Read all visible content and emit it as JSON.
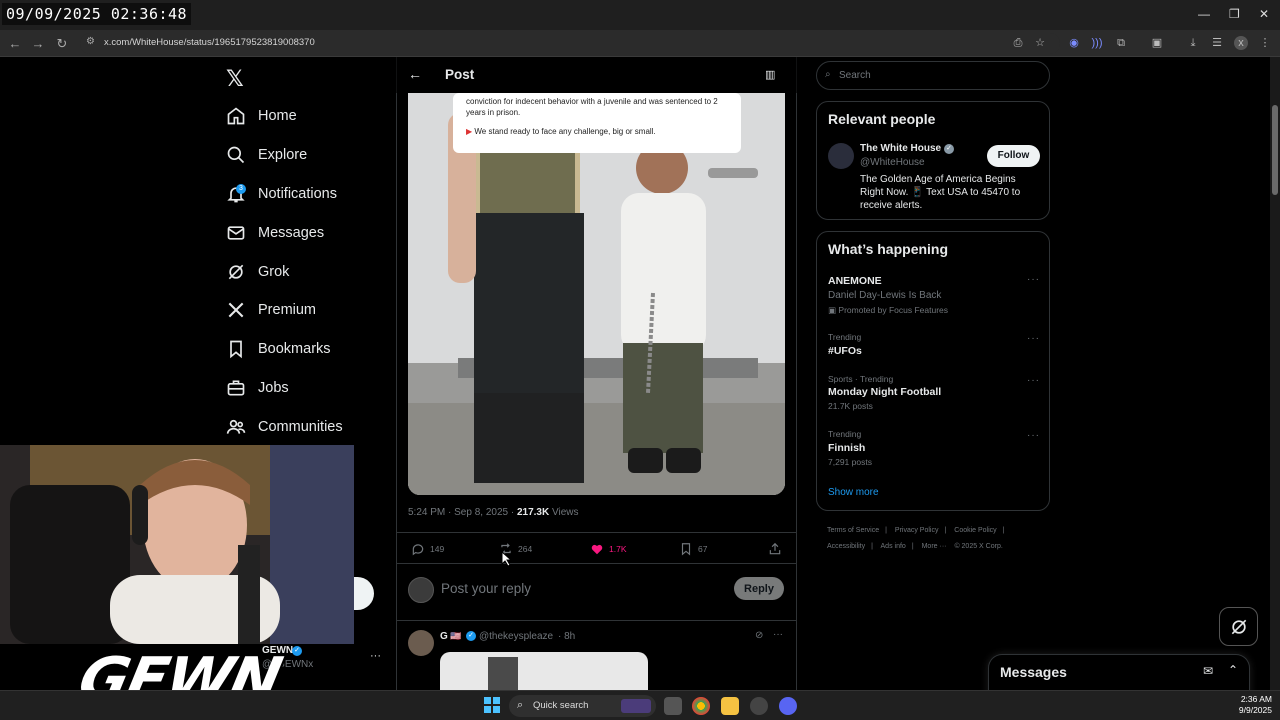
{
  "overlay": {
    "timestamp": "09/09/2025 02:36:48"
  },
  "browser": {
    "url": "x.com/WhiteHouse/status/1965179523819008370"
  },
  "nav": {
    "items": [
      {
        "label": "Home",
        "icon": "home-icon"
      },
      {
        "label": "Explore",
        "icon": "search-icon"
      },
      {
        "label": "Notifications",
        "icon": "bell-icon",
        "badge": "3"
      },
      {
        "label": "Messages",
        "icon": "mail-icon"
      },
      {
        "label": "Grok",
        "icon": "grok-icon"
      },
      {
        "label": "Premium",
        "icon": "x-icon"
      },
      {
        "label": "Bookmarks",
        "icon": "bookmark-icon"
      },
      {
        "label": "Jobs",
        "icon": "briefcase-icon"
      },
      {
        "label": "Communities",
        "icon": "people-icon"
      }
    ],
    "account": {
      "name": "GEWN",
      "handle": "@xGEWNx",
      "more": "···"
    }
  },
  "post": {
    "header_title": "Post",
    "image_caption_lines": [
      "conviction for indecent behavior with a juvenile and was sentenced to 2",
      "years in prison.",
      "We stand ready to face any challenge, big or small."
    ],
    "time": "5:24 PM · Sep 8, 2025 · ",
    "views_count": "217.3K",
    "views_label": " Views",
    "replies": "149",
    "reposts": "264",
    "likes": "1.7K",
    "bookmarks": "67",
    "reply_placeholder": "Post your reply",
    "reply_button": "Reply"
  },
  "comment": {
    "name": "G",
    "handle": "@thekeyspleaze",
    "time": "· 8h",
    "more": "···"
  },
  "sidebar": {
    "search_placeholder": "Search",
    "relevant_title": "Relevant people",
    "relevant": {
      "name": "The White House",
      "handle": "@WhiteHouse",
      "bio": "The Golden Age of America Begins Right Now. 📱 Text USA to 45470 to receive alerts.",
      "follow_label": "Follow"
    },
    "happening_title": "What’s happening",
    "trends": [
      {
        "meta": "",
        "title": "ANEMONE",
        "sub": "Daniel Day-Lewis Is Back",
        "extra": "Promoted by Focus Features"
      },
      {
        "meta": "Trending",
        "title": "#UFOs",
        "sub": "",
        "extra": ""
      },
      {
        "meta": "Sports · Trending",
        "title": "Monday Night Football",
        "sub": "",
        "extra": "21.7K posts"
      },
      {
        "meta": "Trending",
        "title": "Finnish",
        "sub": "",
        "extra": "7,291 posts"
      }
    ],
    "show_more": "Show more",
    "footer": [
      "Terms of Service",
      "|",
      "Privacy Policy",
      "|",
      "Cookie Policy",
      "|",
      "Accessibility",
      "|",
      "Ads info",
      "|",
      "More ···",
      "© 2025 X Corp."
    ]
  },
  "messages_drawer": {
    "title": "Messages"
  },
  "webcam": {
    "overlay_brand": "GEWN"
  },
  "taskbar": {
    "search_label": "Quick search",
    "time": "2:36 AM",
    "date": "9/9/2025"
  },
  "colors": {
    "accent": "#1d9bf0",
    "like": "#f91880",
    "bg": "#000000"
  }
}
